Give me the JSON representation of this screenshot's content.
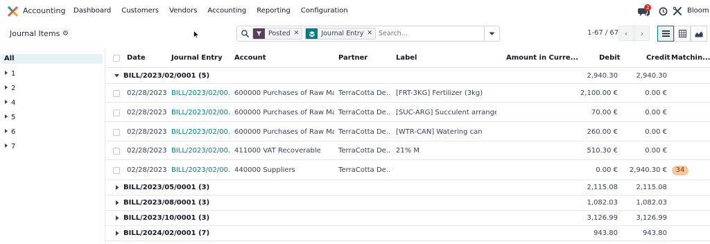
{
  "nav": {
    "app_name": "Accounting",
    "menu": [
      "Dashboard",
      "Customers",
      "Vendors",
      "Accounting",
      "Reporting",
      "Configuration"
    ],
    "chat_badge": "2",
    "user": "Bloom"
  },
  "control": {
    "title": "Journal Items",
    "search": {
      "facets": [
        {
          "icon": "filter-icon",
          "label": "Posted",
          "color": "#5b3e5b"
        },
        {
          "icon": "layers-icon",
          "label": "Journal Entry",
          "color": "#017e84"
        }
      ],
      "placeholder": "Search..."
    },
    "pager": "1-67 / 67"
  },
  "sidebar": {
    "all": "All",
    "items": [
      "1",
      "2",
      "4",
      "5",
      "6",
      "7"
    ]
  },
  "table": {
    "headers": {
      "date": "Date",
      "journal_entry": "Journal Entry",
      "account": "Account",
      "partner": "Partner",
      "label": "Label",
      "amount_currency": "Amount in Curre...",
      "debit": "Debit",
      "credit": "Credit",
      "matching": "Matchin..."
    },
    "open_group": {
      "name": "BILL/2023/02/0001 (5)",
      "debit": "2,940.30",
      "credit": "2,940.30"
    },
    "rows": [
      {
        "date": "02/28/2023",
        "entry": "BILL/2023/02/00...",
        "account": "600000 Purchases of Raw Mat...",
        "partner": "TerraCotta De...",
        "label": "[FRT-3KG] Fertilizer (3kg)",
        "debit": "2,100.00 €",
        "credit": "0.00 €",
        "matching": ""
      },
      {
        "date": "02/28/2023",
        "entry": "BILL/2023/02/00...",
        "account": "600000 Purchases of Raw Mat...",
        "partner": "TerraCotta De...",
        "label": "[SUC-ARG] Succulent arrange...",
        "debit": "70.00 €",
        "credit": "0.00 €",
        "matching": ""
      },
      {
        "date": "02/28/2023",
        "entry": "BILL/2023/02/00...",
        "account": "600000 Purchases of Raw Mat...",
        "partner": "TerraCotta De...",
        "label": "[WTR-CAN] Watering can",
        "debit": "260.00 €",
        "credit": "0.00 €",
        "matching": ""
      },
      {
        "date": "02/28/2023",
        "entry": "BILL/2023/02/00...",
        "account": "411000 VAT Recoverable",
        "partner": "TerraCotta De...",
        "label": "21% M",
        "debit": "510.30 €",
        "credit": "0.00 €",
        "matching": ""
      },
      {
        "date": "02/28/2023",
        "entry": "BILL/2023/02/00...",
        "account": "440000 Suppliers",
        "partner": "TerraCotta De...",
        "label": "",
        "debit": "0.00 €",
        "credit": "2,940.30 €",
        "matching": "34"
      }
    ],
    "closed_groups": [
      {
        "name": "BILL/2023/05/0001 (3)",
        "debit": "2,115.08",
        "credit": "2,115.08"
      },
      {
        "name": "BILL/2023/08/0001 (3)",
        "debit": "1,082.03",
        "credit": "1,082.03"
      },
      {
        "name": "BILL/2023/10/0001 (3)",
        "debit": "3,126.99",
        "credit": "3,126.99"
      },
      {
        "name": "BILL/2024/02/0001 (7)",
        "debit": "943.80",
        "credit": "943.80"
      }
    ]
  },
  "colors": {
    "accent": "#017e84",
    "posted_facet": "#5b3e5b",
    "matching_pill": "#f4c89b",
    "badge": "#dc2626"
  }
}
